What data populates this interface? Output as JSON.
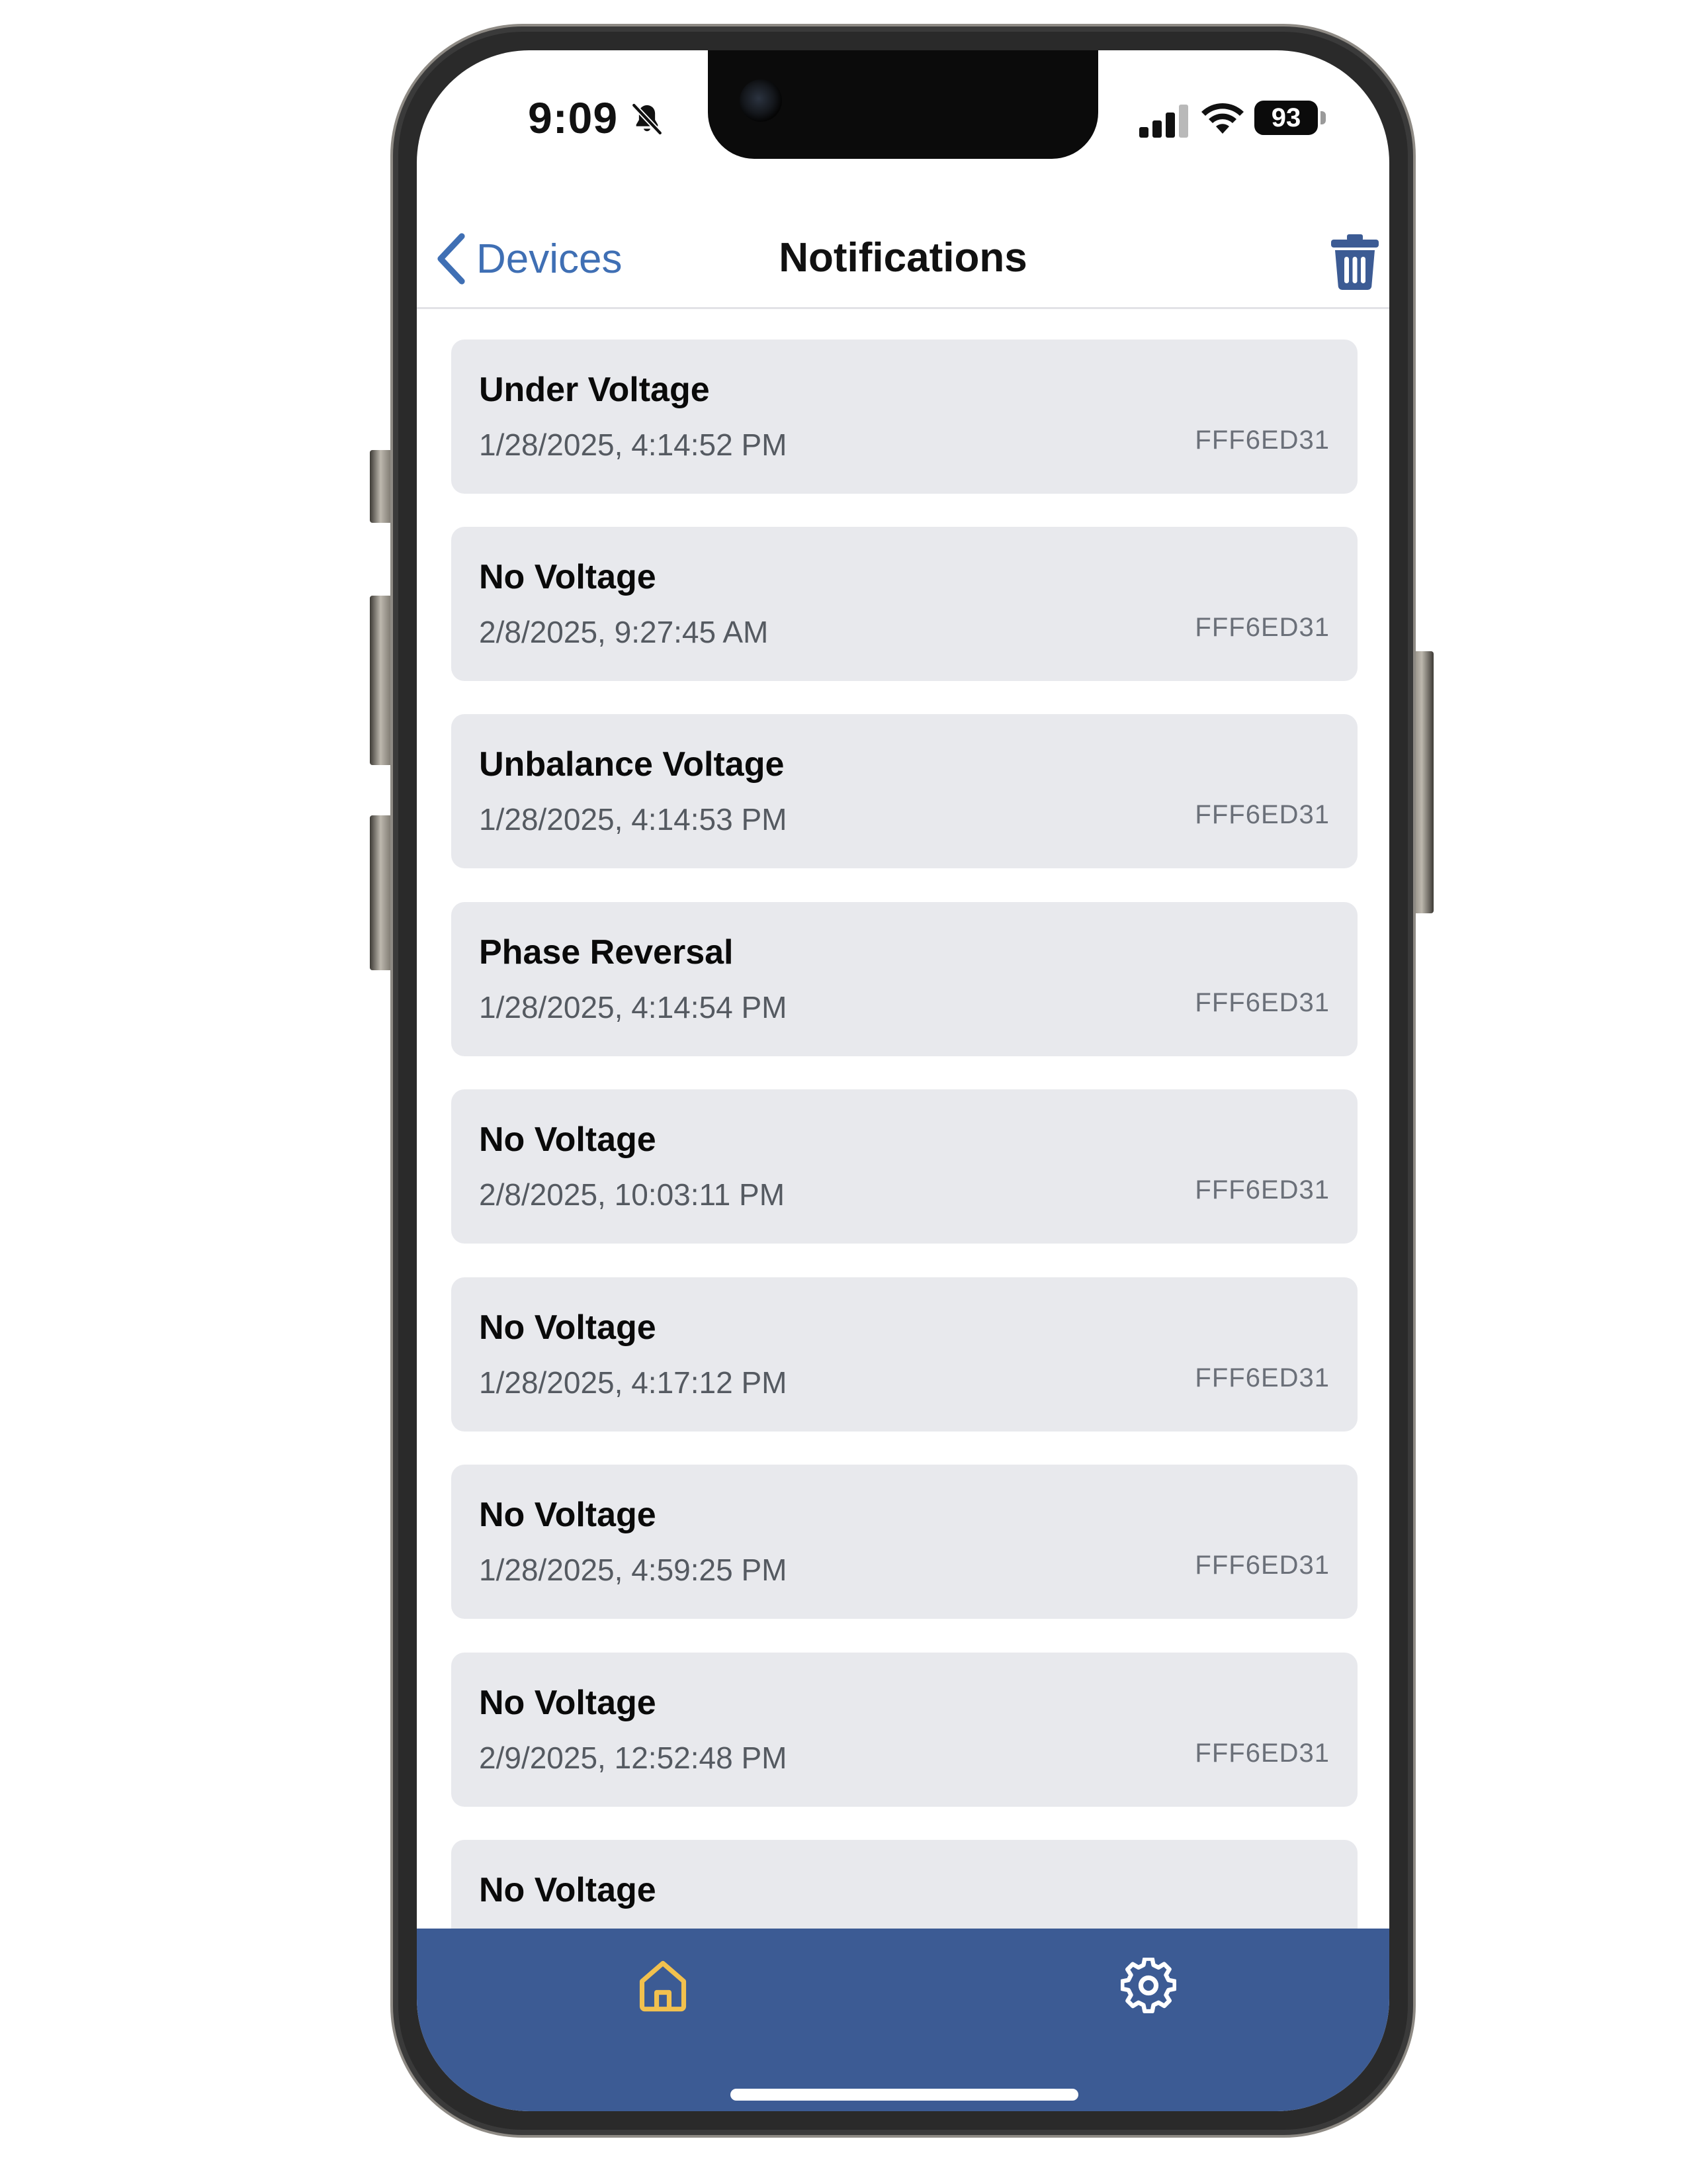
{
  "status_bar": {
    "time": "9:09",
    "battery": "93"
  },
  "nav": {
    "back_label": "Devices",
    "title": "Notifications"
  },
  "notifications": [
    {
      "title": "Under Voltage",
      "time": "1/28/2025, 4:14:52 PM",
      "device": "FFF6ED31"
    },
    {
      "title": "No Voltage",
      "time": "2/8/2025, 9:27:45 AM",
      "device": "FFF6ED31"
    },
    {
      "title": "Unbalance Voltage",
      "time": "1/28/2025, 4:14:53 PM",
      "device": "FFF6ED31"
    },
    {
      "title": "Phase Reversal",
      "time": "1/28/2025, 4:14:54 PM",
      "device": "FFF6ED31"
    },
    {
      "title": "No Voltage",
      "time": "2/8/2025, 10:03:11 PM",
      "device": "FFF6ED31"
    },
    {
      "title": "No Voltage",
      "time": "1/28/2025, 4:17:12 PM",
      "device": "FFF6ED31"
    },
    {
      "title": "No Voltage",
      "time": "1/28/2025, 4:59:25 PM",
      "device": "FFF6ED31"
    },
    {
      "title": "No Voltage",
      "time": "2/9/2025, 12:52:48 PM",
      "device": "FFF6ED31"
    },
    {
      "title": "No Voltage",
      "time": "",
      "device": ""
    }
  ],
  "tabbar": {
    "tabs": [
      {
        "name": "home",
        "icon": "home-icon",
        "active": true
      },
      {
        "name": "settings",
        "icon": "gear-icon",
        "active": false
      }
    ]
  },
  "colors": {
    "accent": "#3F6FB4",
    "tabbar": "#3C5B94",
    "card": "#E8E9ED",
    "home_active": "#F2C14E",
    "tab_icon": "#FFFFFF"
  }
}
